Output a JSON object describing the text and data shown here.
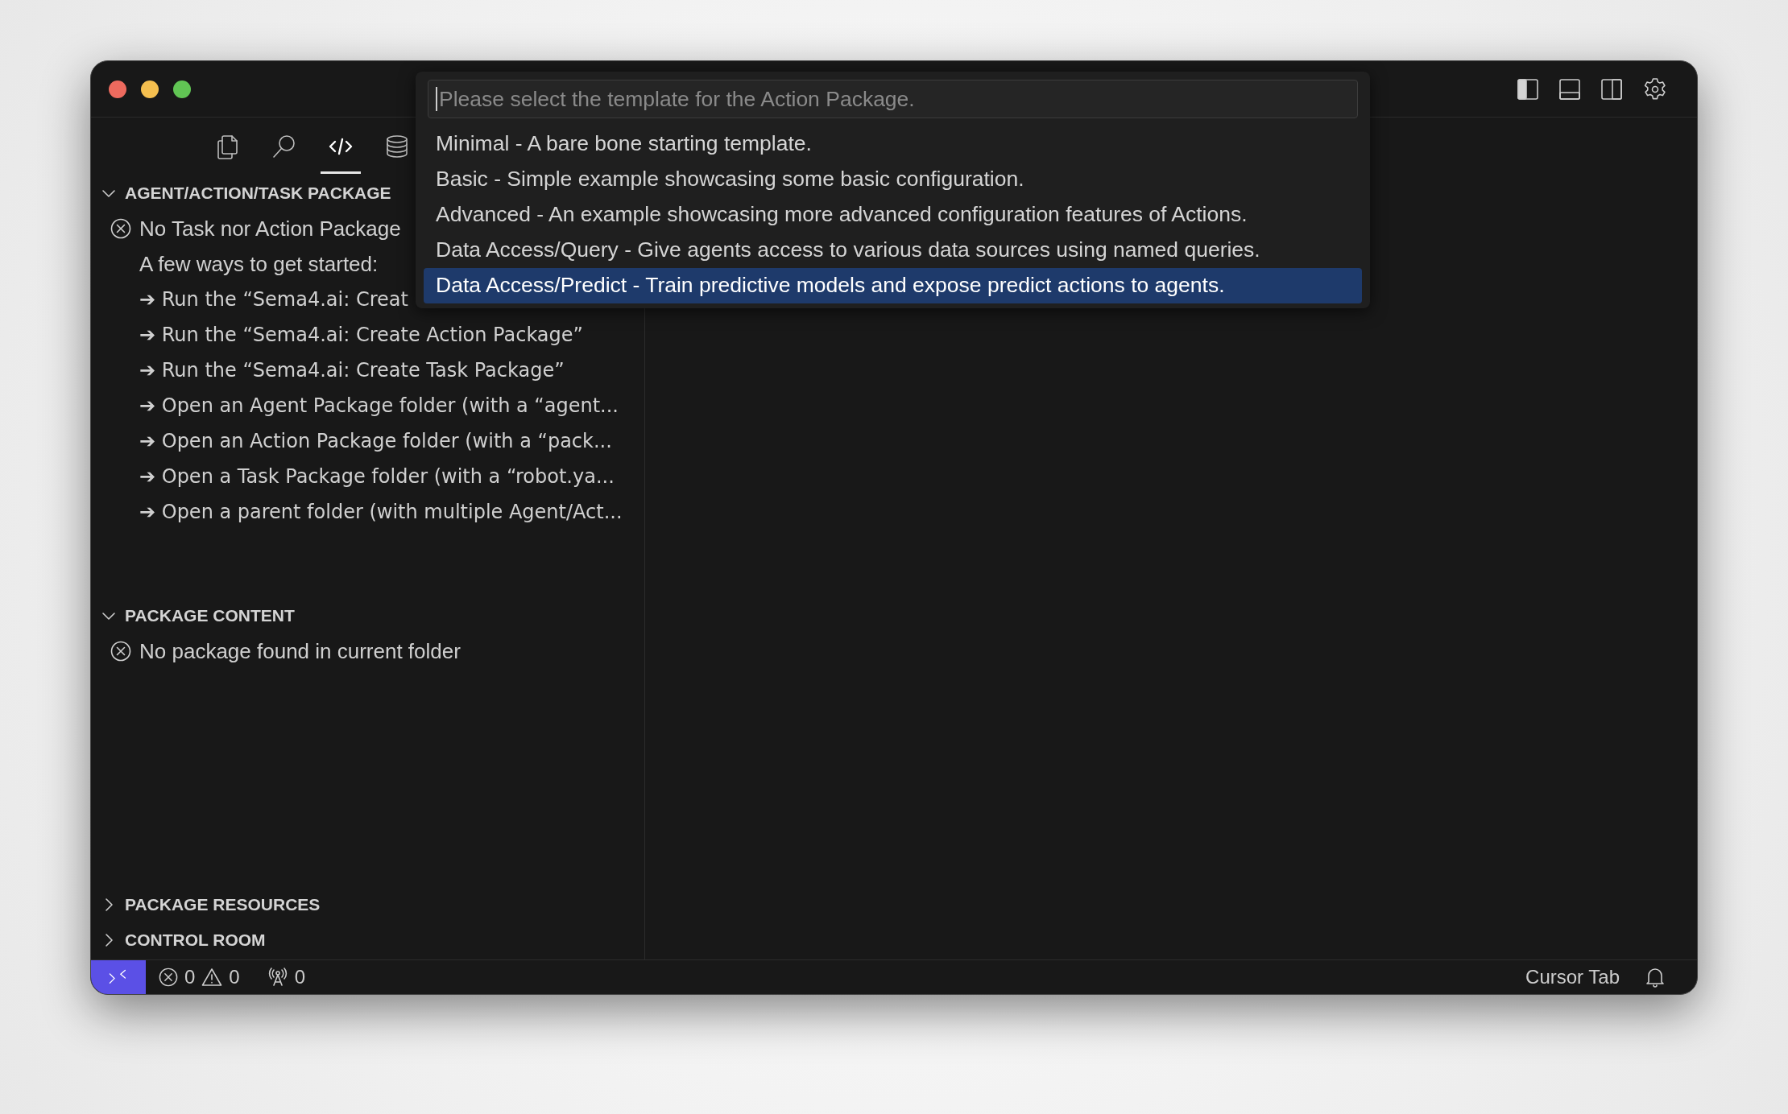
{
  "title_bar": {
    "layout_toggles": [
      {
        "kind": "primary_sidebar",
        "on": true
      },
      {
        "kind": "panel",
        "on": false
      },
      {
        "kind": "secondary_sidebar",
        "on": false
      }
    ]
  },
  "activity_tabs": [
    {
      "kind": "files",
      "selected": false
    },
    {
      "kind": "search",
      "selected": false
    },
    {
      "kind": "code",
      "selected": true
    },
    {
      "kind": "database",
      "selected": false
    }
  ],
  "sidebar": {
    "sections": [
      {
        "title": "AGENT/ACTION/TASK PACKAGE",
        "expanded": true,
        "items": [
          {
            "kind": "error",
            "text": "No Task nor Action Package"
          },
          {
            "kind": "note",
            "text": "A few ways to get started:"
          },
          {
            "kind": "arrow",
            "text": "➔ Run the “Sema4.ai: Creat"
          },
          {
            "kind": "arrow",
            "text": "➔ Run the “Sema4.ai: Create Action Package”"
          },
          {
            "kind": "arrow",
            "text": "➔ Run the “Sema4.ai: Create Task Package”"
          },
          {
            "kind": "arrow",
            "text": "➔ Open an Agent Package folder (with a “agent..."
          },
          {
            "kind": "arrow",
            "text": "➔ Open an Action Package folder (with a “pack..."
          },
          {
            "kind": "arrow",
            "text": "➔ Open a Task Package folder (with a “robot.ya..."
          },
          {
            "kind": "arrow",
            "text": "➔ Open a parent folder (with multiple Agent/Act..."
          }
        ]
      },
      {
        "title": "PACKAGE CONTENT",
        "expanded": true,
        "items": [
          {
            "kind": "error",
            "text": "No package found in current folder"
          }
        ]
      },
      {
        "title": "PACKAGE RESOURCES",
        "expanded": false
      },
      {
        "title": "CONTROL ROOM",
        "expanded": false
      }
    ]
  },
  "quick_pick": {
    "placeholder": "Please select the template for the Action Package.",
    "items": [
      {
        "label": "Minimal - A bare bone starting template.",
        "selected": false
      },
      {
        "label": "Basic - Simple example showcasing some basic configuration.",
        "selected": false
      },
      {
        "label": "Advanced - An example showcasing more advanced configuration features of Actions.",
        "selected": false
      },
      {
        "label": "Data Access/Query - Give agents access to various data sources using named queries.",
        "selected": false
      },
      {
        "label": "Data Access/Predict - Train predictive models and expose predict actions to agents.",
        "selected": true
      }
    ]
  },
  "status_bar": {
    "errors": "0",
    "warnings": "0",
    "ports": "0",
    "right_text": "Cursor Tab"
  }
}
